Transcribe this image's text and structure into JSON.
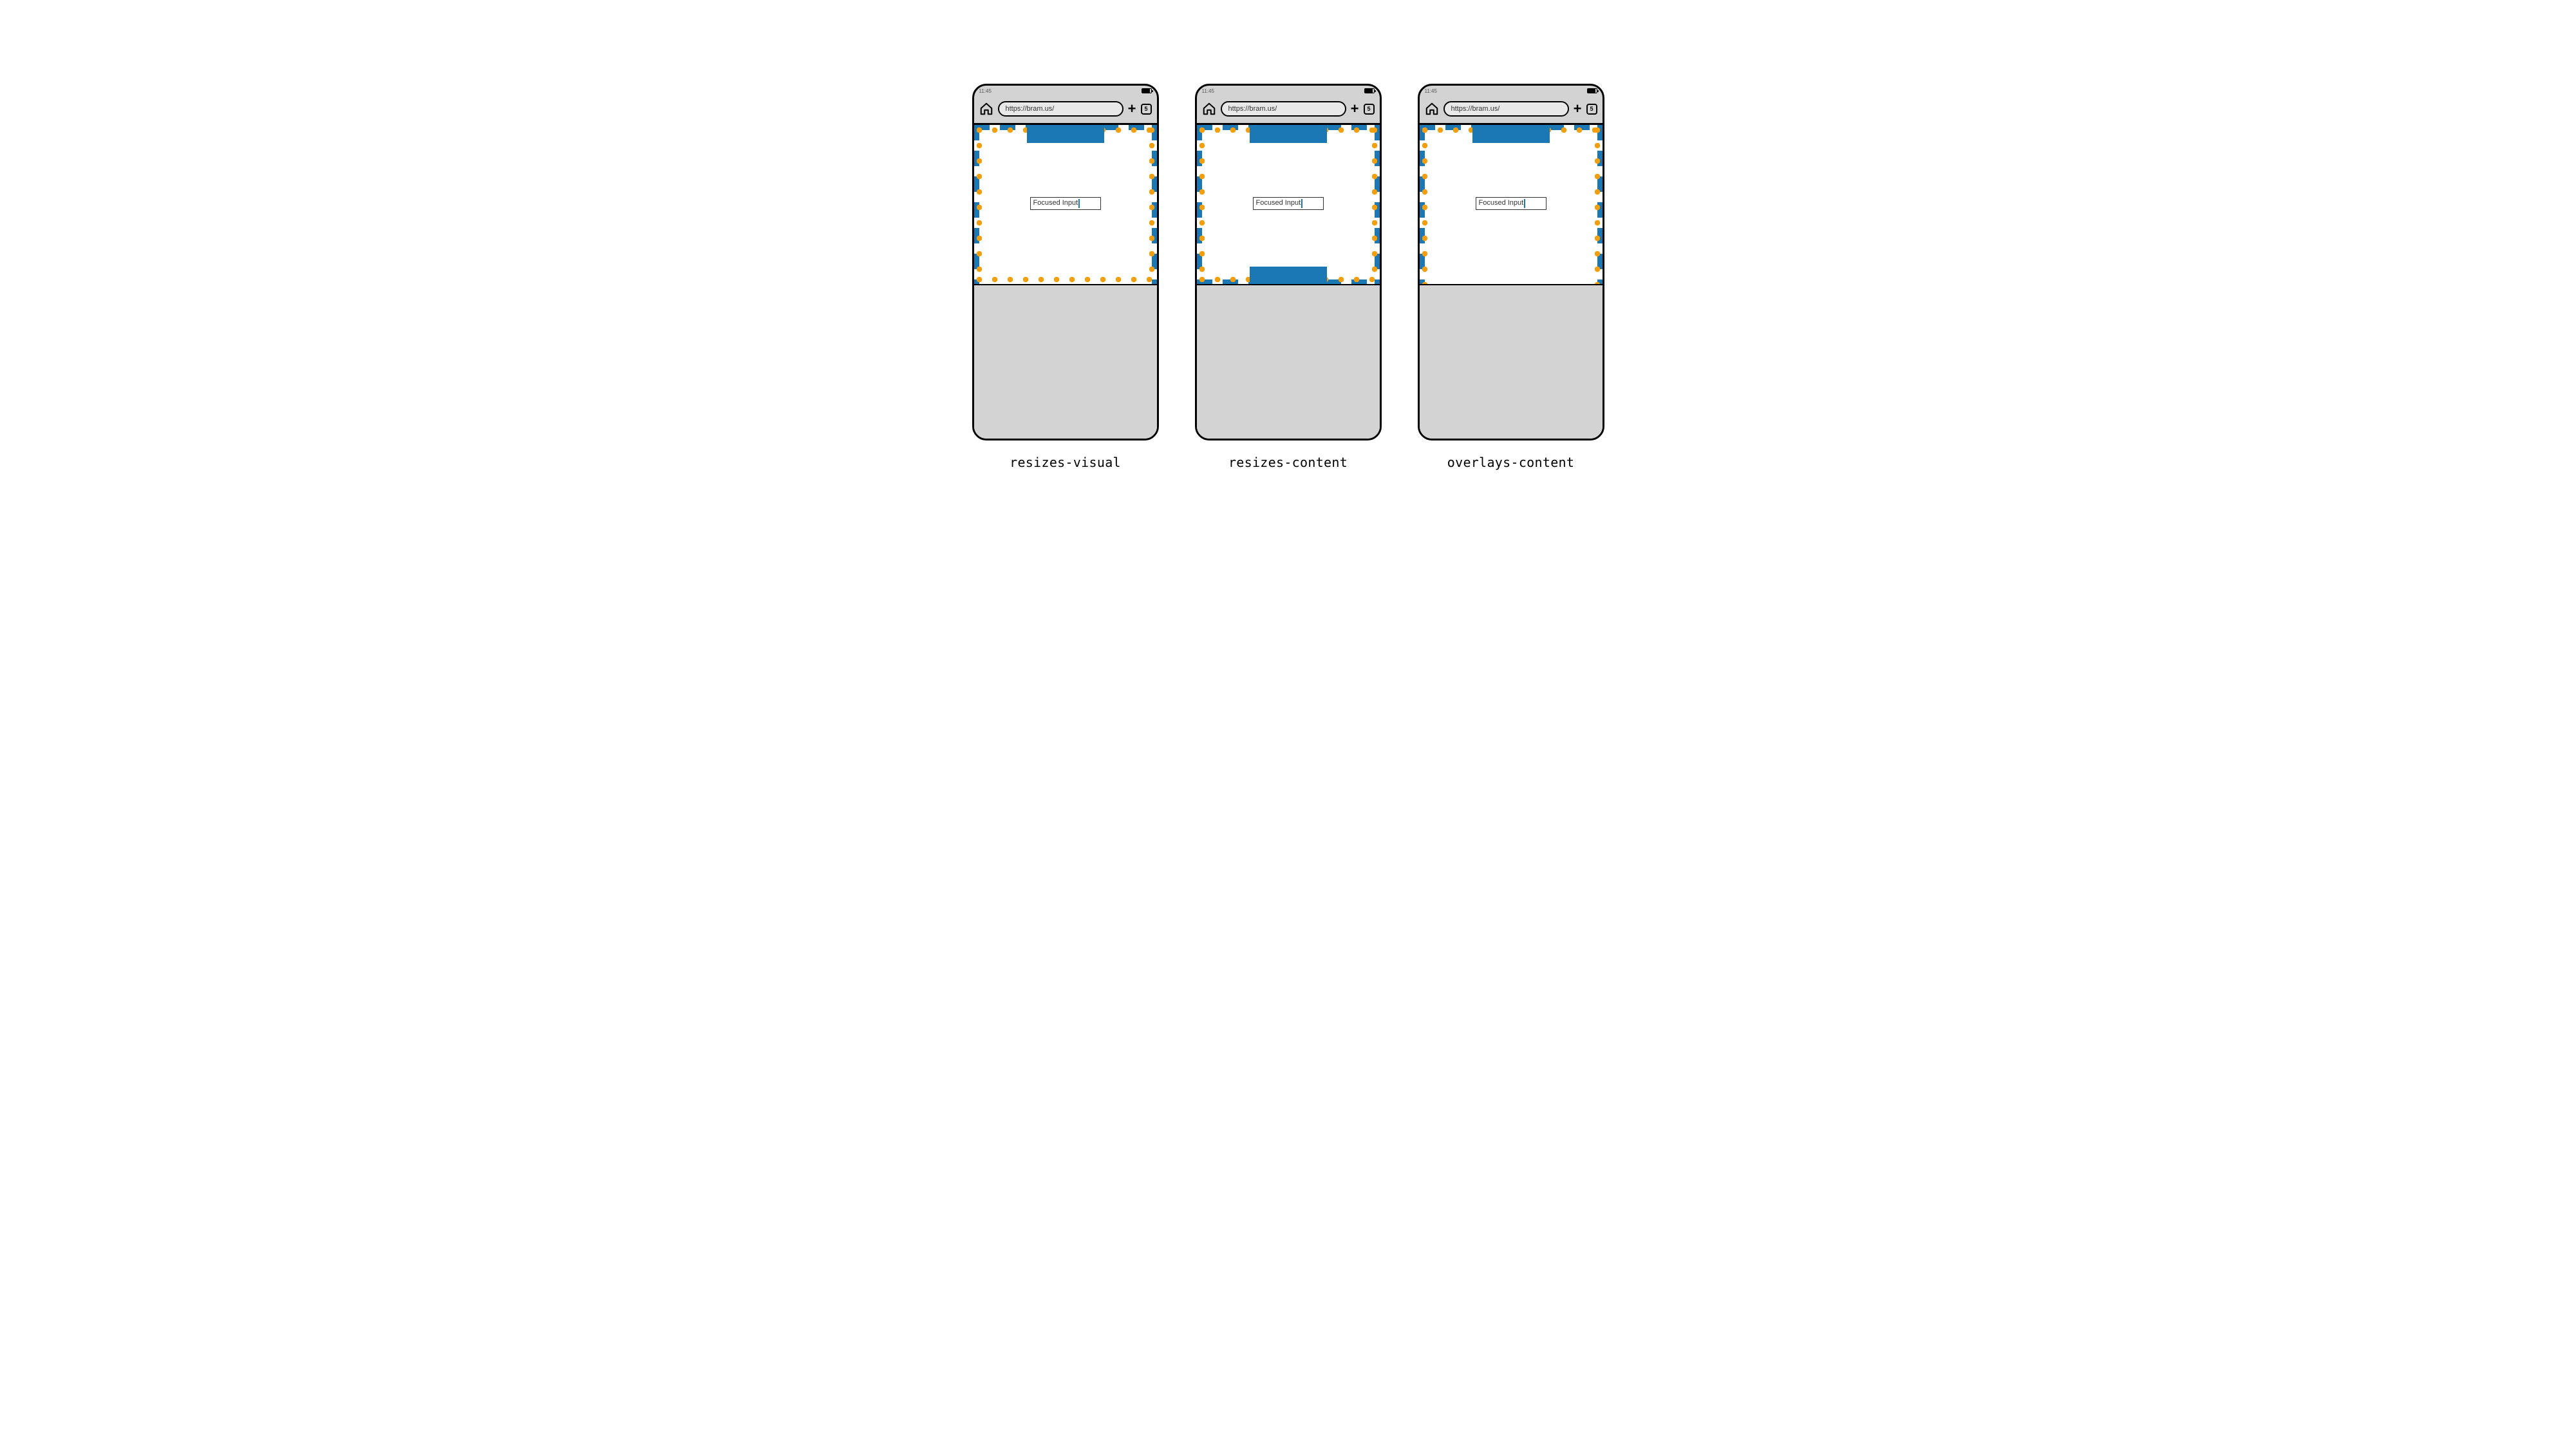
{
  "statusbar": {
    "time": "11:45"
  },
  "addressbar": {
    "url": "https://bram.us/",
    "tab_count": "5"
  },
  "input": {
    "label": "Focused Input"
  },
  "frames": {
    "resizes_visual": {
      "caption": "resizes-visual"
    },
    "resizes_content": {
      "caption": "resizes-content"
    },
    "overlays_content": {
      "caption": "overlays-content"
    }
  },
  "colors": {
    "accent": "#1c78b5",
    "dots": "#f59e0b",
    "chrome_bg": "#d3d3d3"
  }
}
